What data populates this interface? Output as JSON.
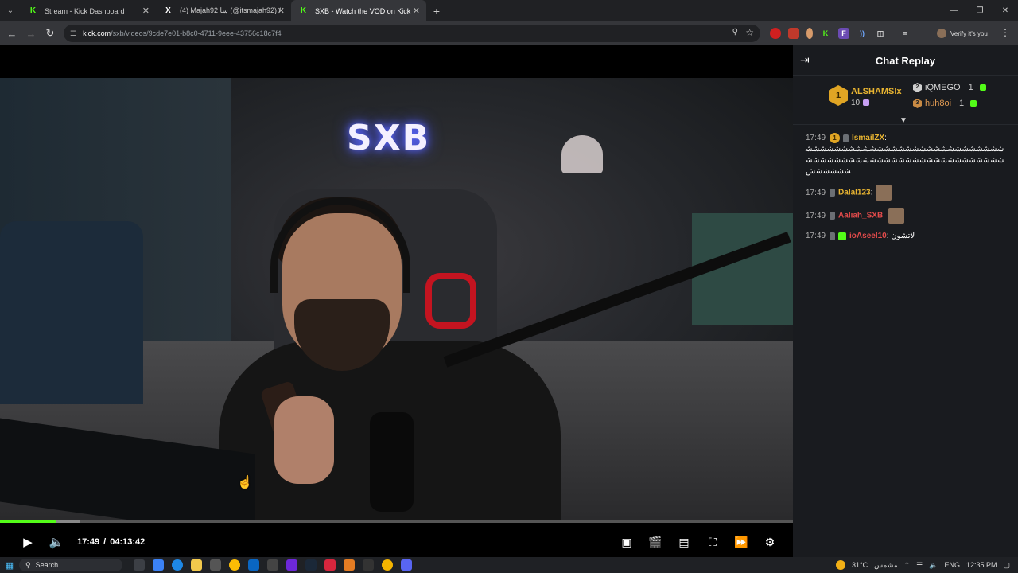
{
  "browser": {
    "tabs": [
      {
        "title": "Stream - Kick Dashboard",
        "favicon": "K",
        "active": false
      },
      {
        "title": "(4) Majah92 سا (@itsmajah92) /",
        "favicon": "X",
        "active": false
      },
      {
        "title": "SXB - Watch the VOD on Kick",
        "favicon": "K",
        "active": true
      }
    ],
    "new_tab_label": "+",
    "url_host": "kick.com",
    "url_path": "/sxb/videos/9cde7e01-b8c0-4711-9eee-43756c18c7f4",
    "profile_label": "Verify it's you"
  },
  "video": {
    "sign_text": "SXB",
    "current_time": "17:49",
    "separator": "/",
    "duration": "04:13:42",
    "progress_fraction": 0.07,
    "buffered_fraction": 0.1,
    "accent_color": "#53fc18"
  },
  "chat": {
    "title": "Chat Replay",
    "leaderboard": {
      "first": {
        "rank": "1",
        "name": "ALSHAMSlx",
        "count": "10"
      },
      "second": {
        "rank": "2",
        "name": "iQMEGO",
        "count": "1"
      },
      "third": {
        "rank": "3",
        "name": "huh8oi",
        "count": "1"
      }
    },
    "messages": [
      {
        "time": "17:49",
        "user": "IsmailZX",
        "color": "#e8b431",
        "text": "شششششششششششششششششششششششششششششششششششششششششششششششششششششششششششششش"
      },
      {
        "time": "17:49",
        "user": "Dalal123",
        "color": "#e8b431",
        "text": ""
      },
      {
        "time": "17:49",
        "user": "Aaliah_SXB",
        "color": "#e34b4b",
        "text": ""
      },
      {
        "time": "17:49",
        "user": "ioAseel10",
        "color": "#e34b4b",
        "text": "لاتشون"
      }
    ]
  },
  "taskbar": {
    "search_placeholder": "Search",
    "weather_temp": "31°C",
    "weather_text": "مشمس",
    "language": "ENG",
    "clock": "12:35 PM"
  }
}
